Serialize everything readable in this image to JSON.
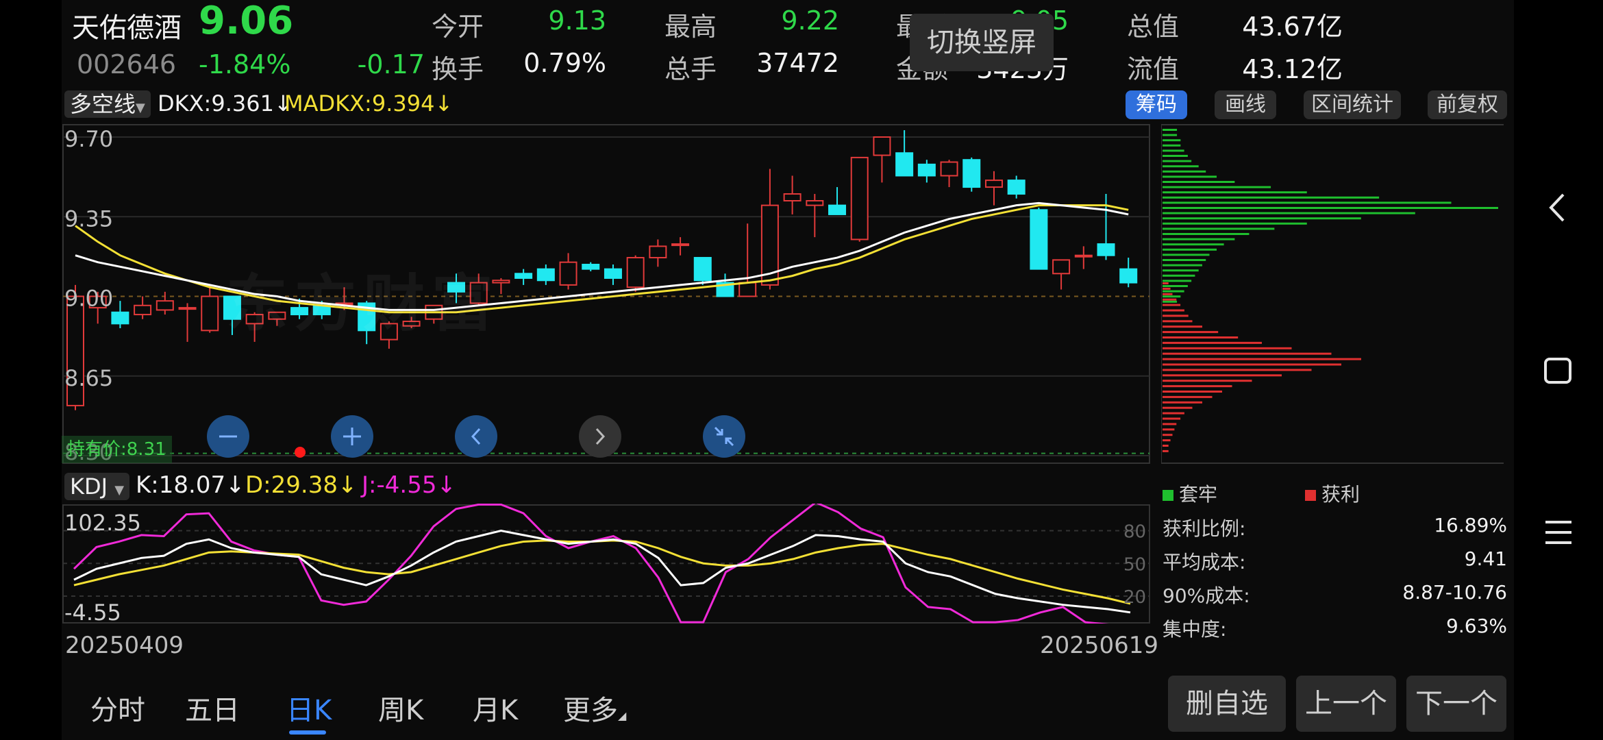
{
  "header": {
    "stock_name": "天佑德酒",
    "price": "9.06",
    "code": "002646",
    "change_pct": "-1.84%",
    "change_amt": "-0.17",
    "stats": [
      {
        "label": "今开",
        "value": "9.13"
      },
      {
        "label": "最高",
        "value": "9.22"
      },
      {
        "label": "最低",
        "value": "9.05"
      },
      {
        "label": "总值",
        "value": "43.67亿"
      },
      {
        "label": "换手",
        "value": "0.79%"
      },
      {
        "label": "总手",
        "value": "37472"
      },
      {
        "label": "金额",
        "value": "3423万"
      },
      {
        "label": "流值",
        "value": "43.12亿"
      }
    ],
    "switch_button": "切换竖屏"
  },
  "indicator_bar": {
    "selector": "多空线",
    "dkx": "DKX:9.361",
    "madkx": "MADKX:9.394",
    "buttons": [
      "筹码",
      "画线",
      "区间统计",
      "前复权"
    ]
  },
  "price_chart": {
    "y_ticks": [
      "9.70",
      "9.35",
      "9.00",
      "8.65",
      "8.30"
    ],
    "watermark": "东方财富",
    "cost_label": "持有价:8.31"
  },
  "kdj": {
    "selector": "KDJ",
    "k": "K:18.07",
    "d": "D:29.38",
    "j": "J:-4.55",
    "y_max": "102.35",
    "y_min": "-4.55",
    "right_ticks": [
      "80",
      "50",
      "20"
    ]
  },
  "date_axis": {
    "start": "20250409",
    "end": "20250619"
  },
  "chips": {
    "legend_trapped": "套牢",
    "legend_profit": "获利",
    "stats": [
      {
        "label": "获利比例:",
        "value": "16.89%"
      },
      {
        "label": "平均成本:",
        "value": "9.41"
      },
      {
        "label": "90%成本:",
        "value": "8.87-10.76"
      },
      {
        "label": "集中度:",
        "value": "9.63%"
      }
    ]
  },
  "bottom_tabs": [
    "分时",
    "五日",
    "日K",
    "周K",
    "月K",
    "更多"
  ],
  "bottom_buttons": [
    "删自选",
    "上一个",
    "下一个"
  ],
  "colors": {
    "up": "#ff4d4d",
    "down": "#21e8f0",
    "accent": "#2f6fdc",
    "ma1": "#ffffff",
    "ma2": "#f3e035",
    "j": "#f02ad8"
  },
  "chart_data": {
    "type": "candlestick",
    "x_start": "20250409",
    "x_end": "20250619",
    "y_range": [
      8.3,
      9.7
    ],
    "candles": [
      {
        "o": 8.52,
        "h": 9.05,
        "l": 8.5,
        "c": 9.0
      },
      {
        "o": 8.95,
        "h": 9.02,
        "l": 8.88,
        "c": 9.0
      },
      {
        "o": 8.93,
        "h": 8.98,
        "l": 8.86,
        "c": 8.88
      },
      {
        "o": 8.92,
        "h": 9.0,
        "l": 8.9,
        "c": 8.96
      },
      {
        "o": 8.94,
        "h": 9.02,
        "l": 8.92,
        "c": 8.98
      },
      {
        "o": 8.95,
        "h": 8.97,
        "l": 8.8,
        "c": 8.95
      },
      {
        "o": 8.85,
        "h": 9.05,
        "l": 8.84,
        "c": 9.0
      },
      {
        "o": 9.0,
        "h": 9.0,
        "l": 8.83,
        "c": 8.9
      },
      {
        "o": 8.88,
        "h": 8.93,
        "l": 8.8,
        "c": 8.92
      },
      {
        "o": 8.9,
        "h": 8.93,
        "l": 8.87,
        "c": 8.93
      },
      {
        "o": 8.95,
        "h": 8.99,
        "l": 8.9,
        "c": 8.92
      },
      {
        "o": 8.96,
        "h": 8.98,
        "l": 8.9,
        "c": 8.92
      },
      {
        "o": 8.97,
        "h": 9.04,
        "l": 8.94,
        "c": 8.97
      },
      {
        "o": 8.97,
        "h": 8.98,
        "l": 8.79,
        "c": 8.85
      },
      {
        "o": 8.81,
        "h": 8.89,
        "l": 8.77,
        "c": 8.88
      },
      {
        "o": 8.87,
        "h": 8.91,
        "l": 8.86,
        "c": 8.89
      },
      {
        "o": 8.9,
        "h": 8.96,
        "l": 8.88,
        "c": 8.96
      },
      {
        "o": 9.06,
        "h": 9.1,
        "l": 8.97,
        "c": 9.02
      },
      {
        "o": 8.97,
        "h": 9.1,
        "l": 8.96,
        "c": 9.06
      },
      {
        "o": 9.06,
        "h": 9.08,
        "l": 9.01,
        "c": 9.07
      },
      {
        "o": 9.1,
        "h": 9.12,
        "l": 9.05,
        "c": 9.08
      },
      {
        "o": 9.12,
        "h": 9.14,
        "l": 9.05,
        "c": 9.07
      },
      {
        "o": 9.05,
        "h": 9.19,
        "l": 9.03,
        "c": 9.15
      },
      {
        "o": 9.14,
        "h": 9.15,
        "l": 9.11,
        "c": 9.12
      },
      {
        "o": 9.12,
        "h": 9.14,
        "l": 9.05,
        "c": 9.08
      },
      {
        "o": 9.04,
        "h": 9.18,
        "l": 9.02,
        "c": 9.17
      },
      {
        "o": 9.17,
        "h": 9.25,
        "l": 9.13,
        "c": 9.22
      },
      {
        "o": 9.23,
        "h": 9.26,
        "l": 9.18,
        "c": 9.23
      },
      {
        "o": 9.17,
        "h": 9.17,
        "l": 9.05,
        "c": 9.07
      },
      {
        "o": 9.06,
        "h": 9.1,
        "l": 9.01,
        "c": 9.0
      },
      {
        "o": 9.0,
        "h": 9.32,
        "l": 9.0,
        "c": 9.06
      },
      {
        "o": 9.05,
        "h": 9.56,
        "l": 9.03,
        "c": 9.4
      },
      {
        "o": 9.42,
        "h": 9.53,
        "l": 9.36,
        "c": 9.45
      },
      {
        "o": 9.4,
        "h": 9.45,
        "l": 9.26,
        "c": 9.42
      },
      {
        "o": 9.4,
        "h": 9.48,
        "l": 9.36,
        "c": 9.36
      },
      {
        "o": 9.25,
        "h": 9.6,
        "l": 9.24,
        "c": 9.61
      },
      {
        "o": 9.62,
        "h": 9.7,
        "l": 9.5,
        "c": 9.7
      },
      {
        "o": 9.63,
        "h": 9.73,
        "l": 9.53,
        "c": 9.53
      },
      {
        "o": 9.58,
        "h": 9.6,
        "l": 9.5,
        "c": 9.53
      },
      {
        "o": 9.53,
        "h": 9.6,
        "l": 9.48,
        "c": 9.59
      },
      {
        "o": 9.6,
        "h": 9.61,
        "l": 9.46,
        "c": 9.48
      },
      {
        "o": 9.48,
        "h": 9.55,
        "l": 9.4,
        "c": 9.51
      },
      {
        "o": 9.51,
        "h": 9.53,
        "l": 9.43,
        "c": 9.45
      },
      {
        "o": 9.38,
        "h": 9.39,
        "l": 9.12,
        "c": 9.12
      },
      {
        "o": 9.1,
        "h": 9.16,
        "l": 9.03,
        "c": 9.16
      },
      {
        "o": 9.18,
        "h": 9.22,
        "l": 9.12,
        "c": 9.18
      },
      {
        "o": 9.23,
        "h": 9.45,
        "l": 9.16,
        "c": 9.18
      },
      {
        "o": 9.12,
        "h": 9.17,
        "l": 9.04,
        "c": 9.06
      }
    ],
    "ma_white": [
      9.18,
      9.15,
      9.13,
      9.11,
      9.09,
      9.07,
      9.05,
      9.03,
      9.01,
      9.0,
      8.98,
      8.97,
      8.96,
      8.95,
      8.94,
      8.94,
      8.94,
      8.95,
      8.96,
      8.97,
      8.98,
      8.99,
      9.0,
      9.01,
      9.02,
      9.03,
      9.04,
      9.05,
      9.06,
      9.07,
      9.08,
      9.1,
      9.13,
      9.15,
      9.17,
      9.2,
      9.24,
      9.28,
      9.31,
      9.34,
      9.36,
      9.38,
      9.4,
      9.41,
      9.4,
      9.39,
      9.38,
      9.36
    ],
    "ma_yellow": [
      9.31,
      9.24,
      9.18,
      9.14,
      9.1,
      9.07,
      9.04,
      9.02,
      9.0,
      8.98,
      8.97,
      8.96,
      8.95,
      8.94,
      8.93,
      8.93,
      8.93,
      8.93,
      8.94,
      8.95,
      8.96,
      8.97,
      8.98,
      8.99,
      9.0,
      9.01,
      9.02,
      9.03,
      9.04,
      9.05,
      9.06,
      9.07,
      9.09,
      9.12,
      9.14,
      9.17,
      9.21,
      9.25,
      9.28,
      9.31,
      9.34,
      9.36,
      9.38,
      9.4,
      9.4,
      9.4,
      9.4,
      9.38
    ],
    "kdj_range": [
      -4.55,
      102.35
    ],
    "k": [
      35,
      45,
      50,
      55,
      57,
      68,
      72,
      64,
      60,
      58,
      56,
      40,
      35,
      30,
      38,
      48,
      60,
      70,
      75,
      80,
      76,
      72,
      68,
      70,
      72,
      68,
      55,
      30,
      32,
      46,
      50,
      58,
      66,
      76,
      75,
      72,
      70,
      50,
      42,
      38,
      30,
      22,
      18,
      15,
      12,
      10,
      8,
      5
    ],
    "d": [
      30,
      35,
      40,
      44,
      48,
      54,
      60,
      61,
      60,
      59,
      58,
      52,
      46,
      42,
      40,
      42,
      48,
      54,
      60,
      66,
      70,
      71,
      70,
      70,
      71,
      70,
      64,
      56,
      50,
      48,
      48,
      50,
      54,
      60,
      64,
      67,
      68,
      63,
      58,
      54,
      48,
      42,
      36,
      31,
      26,
      22,
      18,
      13
    ],
    "j": [
      45,
      65,
      70,
      76,
      75,
      95,
      96,
      70,
      62,
      58,
      56,
      16,
      12,
      15,
      35,
      57,
      84,
      100,
      104,
      104,
      96,
      75,
      64,
      70,
      75,
      64,
      37,
      -4,
      -4,
      42,
      54,
      74,
      90,
      106,
      97,
      82,
      74,
      28,
      10,
      8,
      -4,
      -4,
      -2,
      5,
      10,
      -4,
      -6,
      -8
    ],
    "chip_profit": [
      8,
      10,
      12,
      14,
      16,
      18,
      20,
      22,
      24,
      26,
      30,
      34,
      40,
      48,
      62,
      80,
      110,
      140,
      186,
      160,
      120,
      80,
      60,
      40,
      30,
      24,
      20,
      16,
      14,
      12,
      10,
      10,
      8,
      8
    ],
    "chip_trapped": [
      6,
      8,
      10,
      14,
      18,
      22,
      26,
      30,
      40,
      56,
      76,
      100,
      130,
      170,
      200,
      180,
      150,
      120,
      90,
      70,
      60,
      50,
      40,
      30,
      22,
      18,
      14,
      12,
      10,
      8,
      6,
      6
    ],
    "chip_profit_bars_px": []
  }
}
